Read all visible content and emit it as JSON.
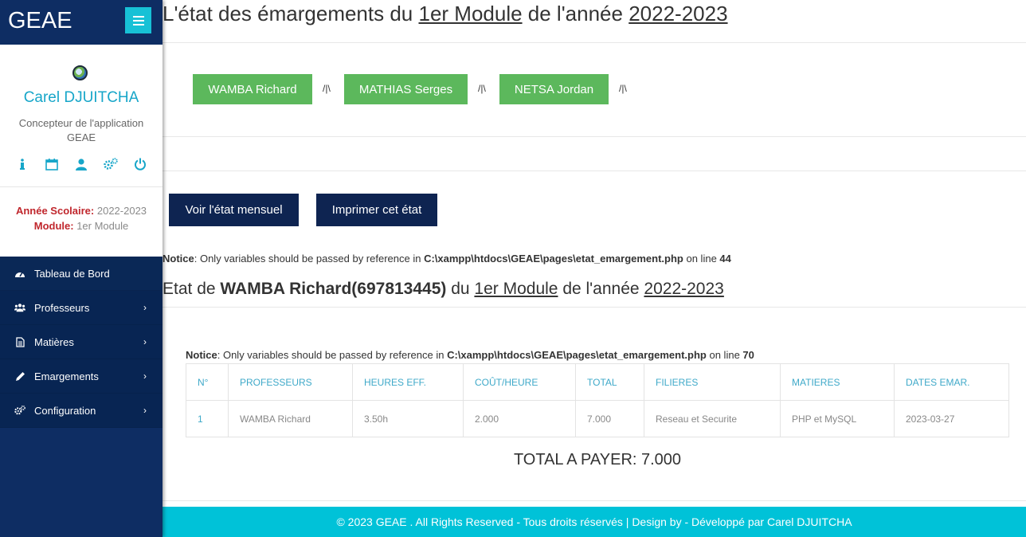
{
  "sidebar": {
    "brand": "GEAE",
    "user_name": "Carel DJUITCHA",
    "user_role": "Concepteur de l'application GEAE",
    "profile_icons": [
      "info-icon",
      "calendar-icon",
      "user-icon",
      "cogs-icon",
      "power-icon"
    ],
    "year_label": "Année Scolaire:",
    "year_value": "2022-2023",
    "module_label": "Module:",
    "module_value": "1er Module",
    "nav": [
      {
        "label": "Tableau de Bord",
        "icon": "dashboard-icon",
        "has_arrow": false
      },
      {
        "label": "Professeurs",
        "icon": "users-icon",
        "has_arrow": true
      },
      {
        "label": "Matières",
        "icon": "file-icon",
        "has_arrow": true
      },
      {
        "label": "Emargements",
        "icon": "pencil-icon",
        "has_arrow": true
      },
      {
        "label": "Configuration",
        "icon": "cogs-icon",
        "has_arrow": true
      }
    ]
  },
  "header": {
    "title_prefix": "L'état des émargements du ",
    "title_module": "1er Module",
    "title_mid": " de l'année ",
    "title_year": "2022-2023"
  },
  "professors": [
    "WAMBA Richard",
    "MATHIAS Serges",
    "NETSA Jordan"
  ],
  "separator": "/|\\",
  "actions": {
    "monthly": "Voir l'état mensuel",
    "print": "Imprimer cet état"
  },
  "notice1": {
    "label": "Notice",
    "text": ": Only variables should be passed by reference in ",
    "path": "C:\\xampp\\htdocs\\GEAE\\pages\\etat_emargement.php",
    "on_line": " on line ",
    "line": "44"
  },
  "subtitle": {
    "prefix": "Etat de ",
    "name": "WAMBA Richard(697813445)",
    "mid": " du ",
    "module": "1er Module",
    "mid2": " de l'année ",
    "year": "2022-2023"
  },
  "notice2": {
    "label": "Notice",
    "text": ": Only variables should be passed by reference in ",
    "path": "C:\\xampp\\htdocs\\GEAE\\pages\\etat_emargement.php",
    "on_line": " on line ",
    "line": "70"
  },
  "table": {
    "headers": [
      "N°",
      "PROFESSEURS",
      "HEURES EFF.",
      "COÛT/HEURE",
      "TOTAL",
      "FILIERES",
      "MATIERES",
      "DATES EMAR."
    ],
    "rows": [
      [
        "1",
        "WAMBA Richard",
        "3.50h",
        "2.000",
        "7.000",
        "Reseau et Securite",
        "PHP et MySQL",
        "2023-03-27"
      ]
    ]
  },
  "total": "TOTAL A PAYER: 7.000",
  "footer": "© 2023 GEAE . All Rights Reserved - Tous droits réservés | Design by - Développé par Carel DJUITCHA",
  "colors": {
    "sidebar": "#0e2d63",
    "accent": "#17c1d6",
    "green": "#5cb85c",
    "dark_button": "#0e2451",
    "footer": "#00c2d8",
    "label_red": "#c0272d"
  }
}
